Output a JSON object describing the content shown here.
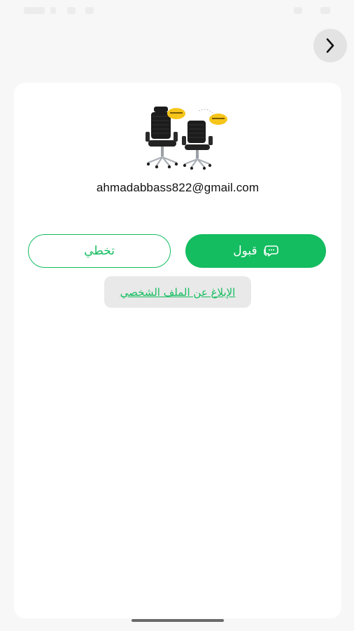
{
  "dialog": {
    "email": "ahmadabbass822@gmail.com",
    "product_image_icon": "office-chairs-product-image"
  },
  "actions": {
    "skip_label": "تخطي",
    "accept_label": "قبول",
    "accept_icon": "chat-bubble-icon",
    "report_label": "الإبلاغ عن الملف الشخصي"
  },
  "navigation": {
    "back_icon": "chevron-right-icon"
  },
  "colors": {
    "accent": "#14bd60",
    "background": "#f7f7f7",
    "card": "#ffffff"
  }
}
